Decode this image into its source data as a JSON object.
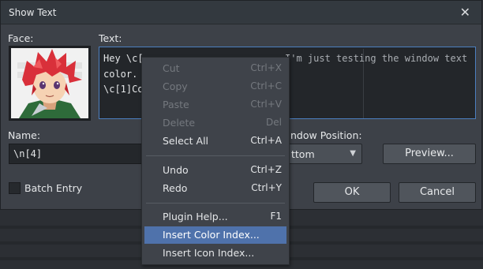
{
  "window": {
    "title": "Show Text",
    "close_icon": "close-icon"
  },
  "labels": {
    "face": "Face:",
    "text": "Text:",
    "name": "Name:",
    "window_position": "ndow Position:",
    "batch_entry": "Batch Entry"
  },
  "text_area": {
    "lines": [
      "Hey \\c[",
      "color.",
      "\\c[1]Co"
    ],
    "line1_tail": "I'm just testing the window text"
  },
  "name_field": {
    "value": "\\n[4]"
  },
  "window_position": {
    "selected": "ttom"
  },
  "buttons": {
    "preview": "Preview...",
    "ok": "OK",
    "cancel": "Cancel"
  },
  "context_menu": {
    "items": [
      {
        "label": "Cut",
        "shortcut": "Ctrl+X",
        "enabled": false
      },
      {
        "label": "Copy",
        "shortcut": "Ctrl+C",
        "enabled": false
      },
      {
        "label": "Paste",
        "shortcut": "Ctrl+V",
        "enabled": false
      },
      {
        "label": "Delete",
        "shortcut": "Del",
        "enabled": false
      },
      {
        "label": "Select All",
        "shortcut": "Ctrl+A",
        "enabled": true
      },
      {
        "label": "Undo",
        "shortcut": "Ctrl+Z",
        "enabled": true
      },
      {
        "label": "Redo",
        "shortcut": "Ctrl+Y",
        "enabled": true
      },
      {
        "label": "Plugin Help...",
        "shortcut": "F1",
        "enabled": true
      },
      {
        "label": "Insert Color Index...",
        "shortcut": "",
        "enabled": true,
        "highlighted": true
      },
      {
        "label": "Insert Icon Index...",
        "shortcut": "",
        "enabled": true
      }
    ]
  },
  "colors": {
    "accent": "#4c7fc0",
    "highlight": "#4f72ab"
  }
}
